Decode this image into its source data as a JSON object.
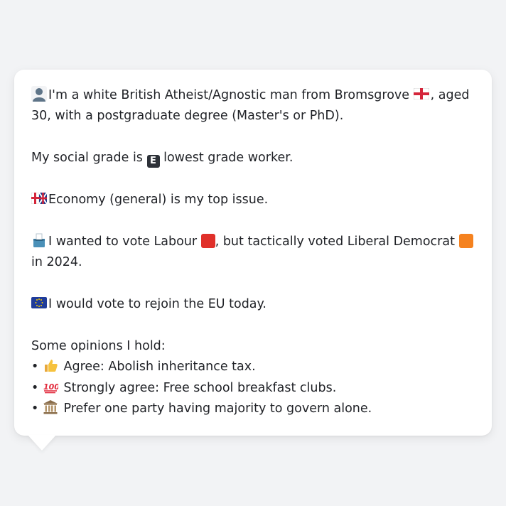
{
  "profile": {
    "intro_a": "I'm a white British Atheist/Agnostic man from Bromsgrove",
    "intro_b": ", aged 30, with a postgraduate degree (Master's or PhD).",
    "social_a": "My social grade is",
    "social_badge": "E",
    "social_b": "lowest grade worker.",
    "issue": "Economy (general) is my top issue.",
    "vote_a": "I wanted to vote Labour",
    "vote_b": ", but tactically voted Liberal Democrat",
    "vote_c": "in 2024.",
    "eu": "I would vote to rejoin the EU today.",
    "opinions_heading": "Some opinions I hold:",
    "opinions": [
      {
        "bullet": "•",
        "text": "Agree: Abolish inheritance tax.",
        "icon": "thumbs-up-icon"
      },
      {
        "bullet": "•",
        "text": "Strongly agree: Free school breakfast clubs.",
        "icon": "hundred-points-icon"
      },
      {
        "bullet": "•",
        "text": "Prefer one party having majority to govern alone.",
        "icon": "classical-building-icon"
      }
    ]
  },
  "icons": {
    "person": "person-silhouette-icon",
    "flag": "england-flag-icon",
    "grade": "letter-e-badge-icon",
    "issue": "mixed-flag-icon",
    "vote": "ballot-box-icon",
    "eu": "eu-flag-icon"
  },
  "colors": {
    "labour": "#e0302a",
    "libdem": "#f5821f",
    "background": "#f2f3f5",
    "card": "#ffffff",
    "text": "#1f2126"
  }
}
